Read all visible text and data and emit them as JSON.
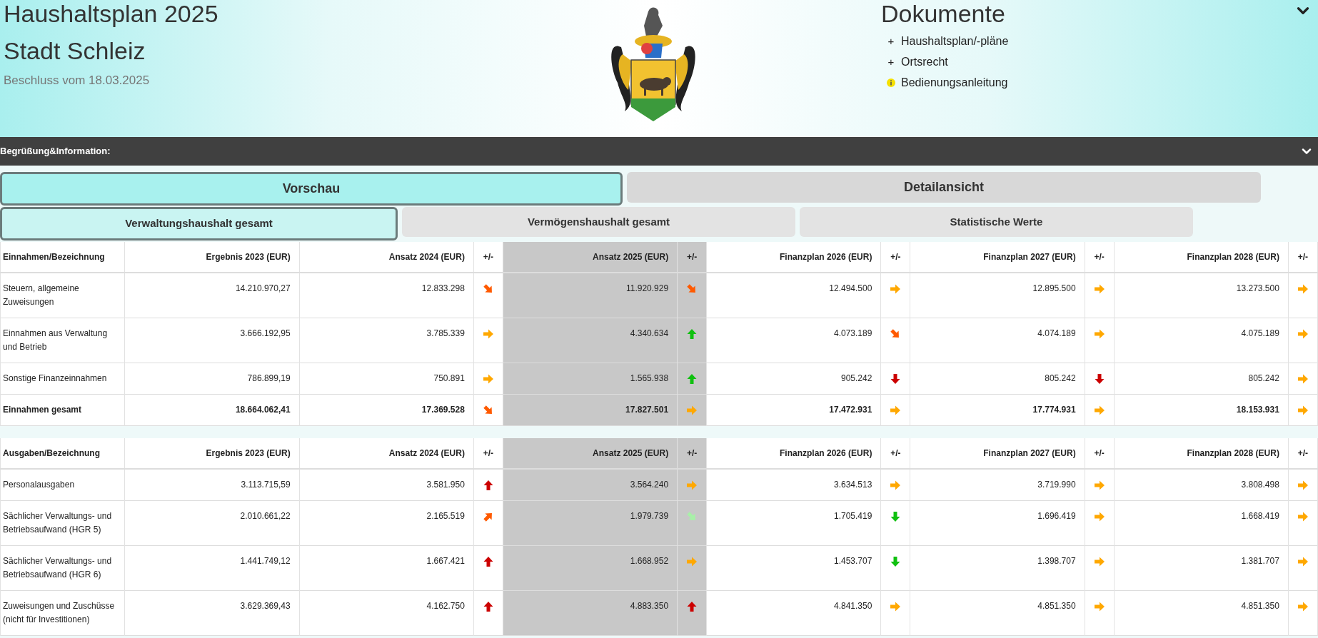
{
  "header": {
    "title": "Haushaltsplan 2025",
    "subtitle": "Stadt Schleiz",
    "resolution": "Beschluss vom 18.03.2025"
  },
  "documents": {
    "title": "Dokumente",
    "items": [
      {
        "kind": "expand",
        "marker": "+",
        "label": "Haushaltsplan/-pläne"
      },
      {
        "kind": "expand",
        "marker": "+",
        "label": "Ortsrecht"
      },
      {
        "kind": "info",
        "label": "Bedienungsanleitung"
      }
    ]
  },
  "info_bar": {
    "label": "Begrüßung&Information:",
    "expanded": false
  },
  "view_tabs": [
    {
      "label": "Vorschau",
      "selected": true
    },
    {
      "label": "Detailansicht",
      "selected": false
    }
  ],
  "section_tabs": [
    {
      "label": "Verwaltungshaushalt gesamt",
      "selected": true
    },
    {
      "label": "Vermögenshaushalt gesamt",
      "selected": false
    },
    {
      "label": "Statistische Werte",
      "selected": false
    }
  ],
  "tables": [
    {
      "columns": [
        {
          "kind": "label",
          "title": "Einnahmen/Bezeichnung",
          "highlighted": false
        },
        {
          "kind": "amount",
          "title": "Ergebnis 2023 (EUR)",
          "highlighted": false
        },
        {
          "kind": "amount",
          "title": "Ansatz 2024 (EUR)",
          "highlighted": false
        },
        {
          "kind": "trend",
          "title": "+/-",
          "highlighted": false
        },
        {
          "kind": "amount",
          "title": "Ansatz 2025 (EUR)",
          "highlighted": true
        },
        {
          "kind": "trend",
          "title": "+/-",
          "highlighted": true
        },
        {
          "kind": "amount",
          "title": "Finanzplan 2026 (EUR)",
          "highlighted": false
        },
        {
          "kind": "trend",
          "title": "+/-",
          "highlighted": false
        },
        {
          "kind": "amount",
          "title": "Finanzplan 2027 (EUR)",
          "highlighted": false
        },
        {
          "kind": "trend",
          "title": "+/-",
          "highlighted": false
        },
        {
          "kind": "amount",
          "title": "Finanzplan 2028 (EUR)",
          "highlighted": false
        },
        {
          "kind": "trend",
          "title": "+/-",
          "highlighted": false
        }
      ],
      "rows": [
        {
          "total": false,
          "cells": [
            {
              "text": "Steuern, allgemeine Zuweisungen"
            },
            {
              "text": "14.210.970,27"
            },
            {
              "text": "12.833.298"
            },
            {
              "kind": "fall"
            },
            {
              "text": "11.920.929"
            },
            {
              "kind": "fall"
            },
            {
              "text": "12.494.500"
            },
            {
              "kind": "steady"
            },
            {
              "text": "12.895.500"
            },
            {
              "kind": "steady"
            },
            {
              "text": "13.273.500"
            },
            {
              "kind": "steady"
            }
          ]
        },
        {
          "total": false,
          "cells": [
            {
              "text": "Einnahmen aus Verwaltung und Betrieb"
            },
            {
              "text": "3.666.192,95"
            },
            {
              "text": "3.785.339"
            },
            {
              "kind": "steady"
            },
            {
              "text": "4.340.634"
            },
            {
              "kind": "risegood"
            },
            {
              "text": "4.073.189"
            },
            {
              "kind": "fall"
            },
            {
              "text": "4.074.189"
            },
            {
              "kind": "steady"
            },
            {
              "text": "4.075.189"
            },
            {
              "kind": "steady"
            }
          ]
        },
        {
          "total": false,
          "cells": [
            {
              "text": "Sonstige Finanzeinnahmen"
            },
            {
              "text": "786.899,19"
            },
            {
              "text": "750.891"
            },
            {
              "kind": "steady"
            },
            {
              "text": "1.565.938"
            },
            {
              "kind": "risegood"
            },
            {
              "text": "905.242"
            },
            {
              "kind": "fallbad"
            },
            {
              "text": "805.242"
            },
            {
              "kind": "fallbad"
            },
            {
              "text": "805.242"
            },
            {
              "kind": "steady"
            }
          ]
        },
        {
          "total": true,
          "cells": [
            {
              "text": "Einnahmen gesamt"
            },
            {
              "text": "18.664.062,41"
            },
            {
              "text": "17.369.528"
            },
            {
              "kind": "fall"
            },
            {
              "text": "17.827.501"
            },
            {
              "kind": "steady"
            },
            {
              "text": "17.472.931"
            },
            {
              "kind": "steady"
            },
            {
              "text": "17.774.931"
            },
            {
              "kind": "steady"
            },
            {
              "text": "18.153.931"
            },
            {
              "kind": "steady"
            }
          ]
        }
      ]
    },
    {
      "columns": [
        {
          "kind": "label",
          "title": "Ausgaben/Bezeichnung",
          "highlighted": false
        },
        {
          "kind": "amount",
          "title": "Ergebnis 2023 (EUR)",
          "highlighted": false
        },
        {
          "kind": "amount",
          "title": "Ansatz 2024 (EUR)",
          "highlighted": false
        },
        {
          "kind": "trend",
          "title": "+/-",
          "highlighted": false
        },
        {
          "kind": "amount",
          "title": "Ansatz 2025 (EUR)",
          "highlighted": true
        },
        {
          "kind": "trend",
          "title": "+/-",
          "highlighted": true
        },
        {
          "kind": "amount",
          "title": "Finanzplan 2026 (EUR)",
          "highlighted": false
        },
        {
          "kind": "trend",
          "title": "+/-",
          "highlighted": false
        },
        {
          "kind": "amount",
          "title": "Finanzplan 2027 (EUR)",
          "highlighted": false
        },
        {
          "kind": "trend",
          "title": "+/-",
          "highlighted": false
        },
        {
          "kind": "amount",
          "title": "Finanzplan 2028 (EUR)",
          "highlighted": false
        },
        {
          "kind": "trend",
          "title": "+/-",
          "highlighted": false
        }
      ],
      "rows": [
        {
          "total": false,
          "cells": [
            {
              "text": "Personalausgaben"
            },
            {
              "text": "3.113.715,59"
            },
            {
              "text": "3.581.950"
            },
            {
              "kind": "risebad"
            },
            {
              "text": "3.564.240"
            },
            {
              "kind": "steady"
            },
            {
              "text": "3.634.513"
            },
            {
              "kind": "steady"
            },
            {
              "text": "3.719.990"
            },
            {
              "kind": "steady"
            },
            {
              "text": "3.808.498"
            },
            {
              "kind": "steady"
            }
          ]
        },
        {
          "total": false,
          "cells": [
            {
              "text": "Sächlicher Verwaltungs- und Betriebsaufwand (HGR 5)"
            },
            {
              "text": "2.010.661,22"
            },
            {
              "text": "2.165.519"
            },
            {
              "kind": "rise"
            },
            {
              "text": "1.979.739"
            },
            {
              "kind": "falllight"
            },
            {
              "text": "1.705.419"
            },
            {
              "kind": "fallgood"
            },
            {
              "text": "1.696.419"
            },
            {
              "kind": "steady"
            },
            {
              "text": "1.668.419"
            },
            {
              "kind": "steady"
            }
          ]
        },
        {
          "total": false,
          "cells": [
            {
              "text": "Sächlicher Verwaltungs- und Betriebsaufwand (HGR 6)"
            },
            {
              "text": "1.441.749,12"
            },
            {
              "text": "1.667.421"
            },
            {
              "kind": "risebad"
            },
            {
              "text": "1.668.952"
            },
            {
              "kind": "steady"
            },
            {
              "text": "1.453.707"
            },
            {
              "kind": "fallgood"
            },
            {
              "text": "1.398.707"
            },
            {
              "kind": "steady"
            },
            {
              "text": "1.381.707"
            },
            {
              "kind": "steady"
            }
          ]
        },
        {
          "total": false,
          "cells": [
            {
              "text": "Zuweisungen und Zuschüsse (nicht für Investitionen)"
            },
            {
              "text": "3.629.369,43"
            },
            {
              "text": "4.162.750"
            },
            {
              "kind": "risebad"
            },
            {
              "text": "4.883.350"
            },
            {
              "kind": "risebad"
            },
            {
              "text": "4.841.350"
            },
            {
              "kind": "steady"
            },
            {
              "text": "4.851.350"
            },
            {
              "kind": "steady"
            },
            {
              "text": "4.851.350"
            },
            {
              "kind": "steady"
            }
          ]
        }
      ]
    }
  ]
}
